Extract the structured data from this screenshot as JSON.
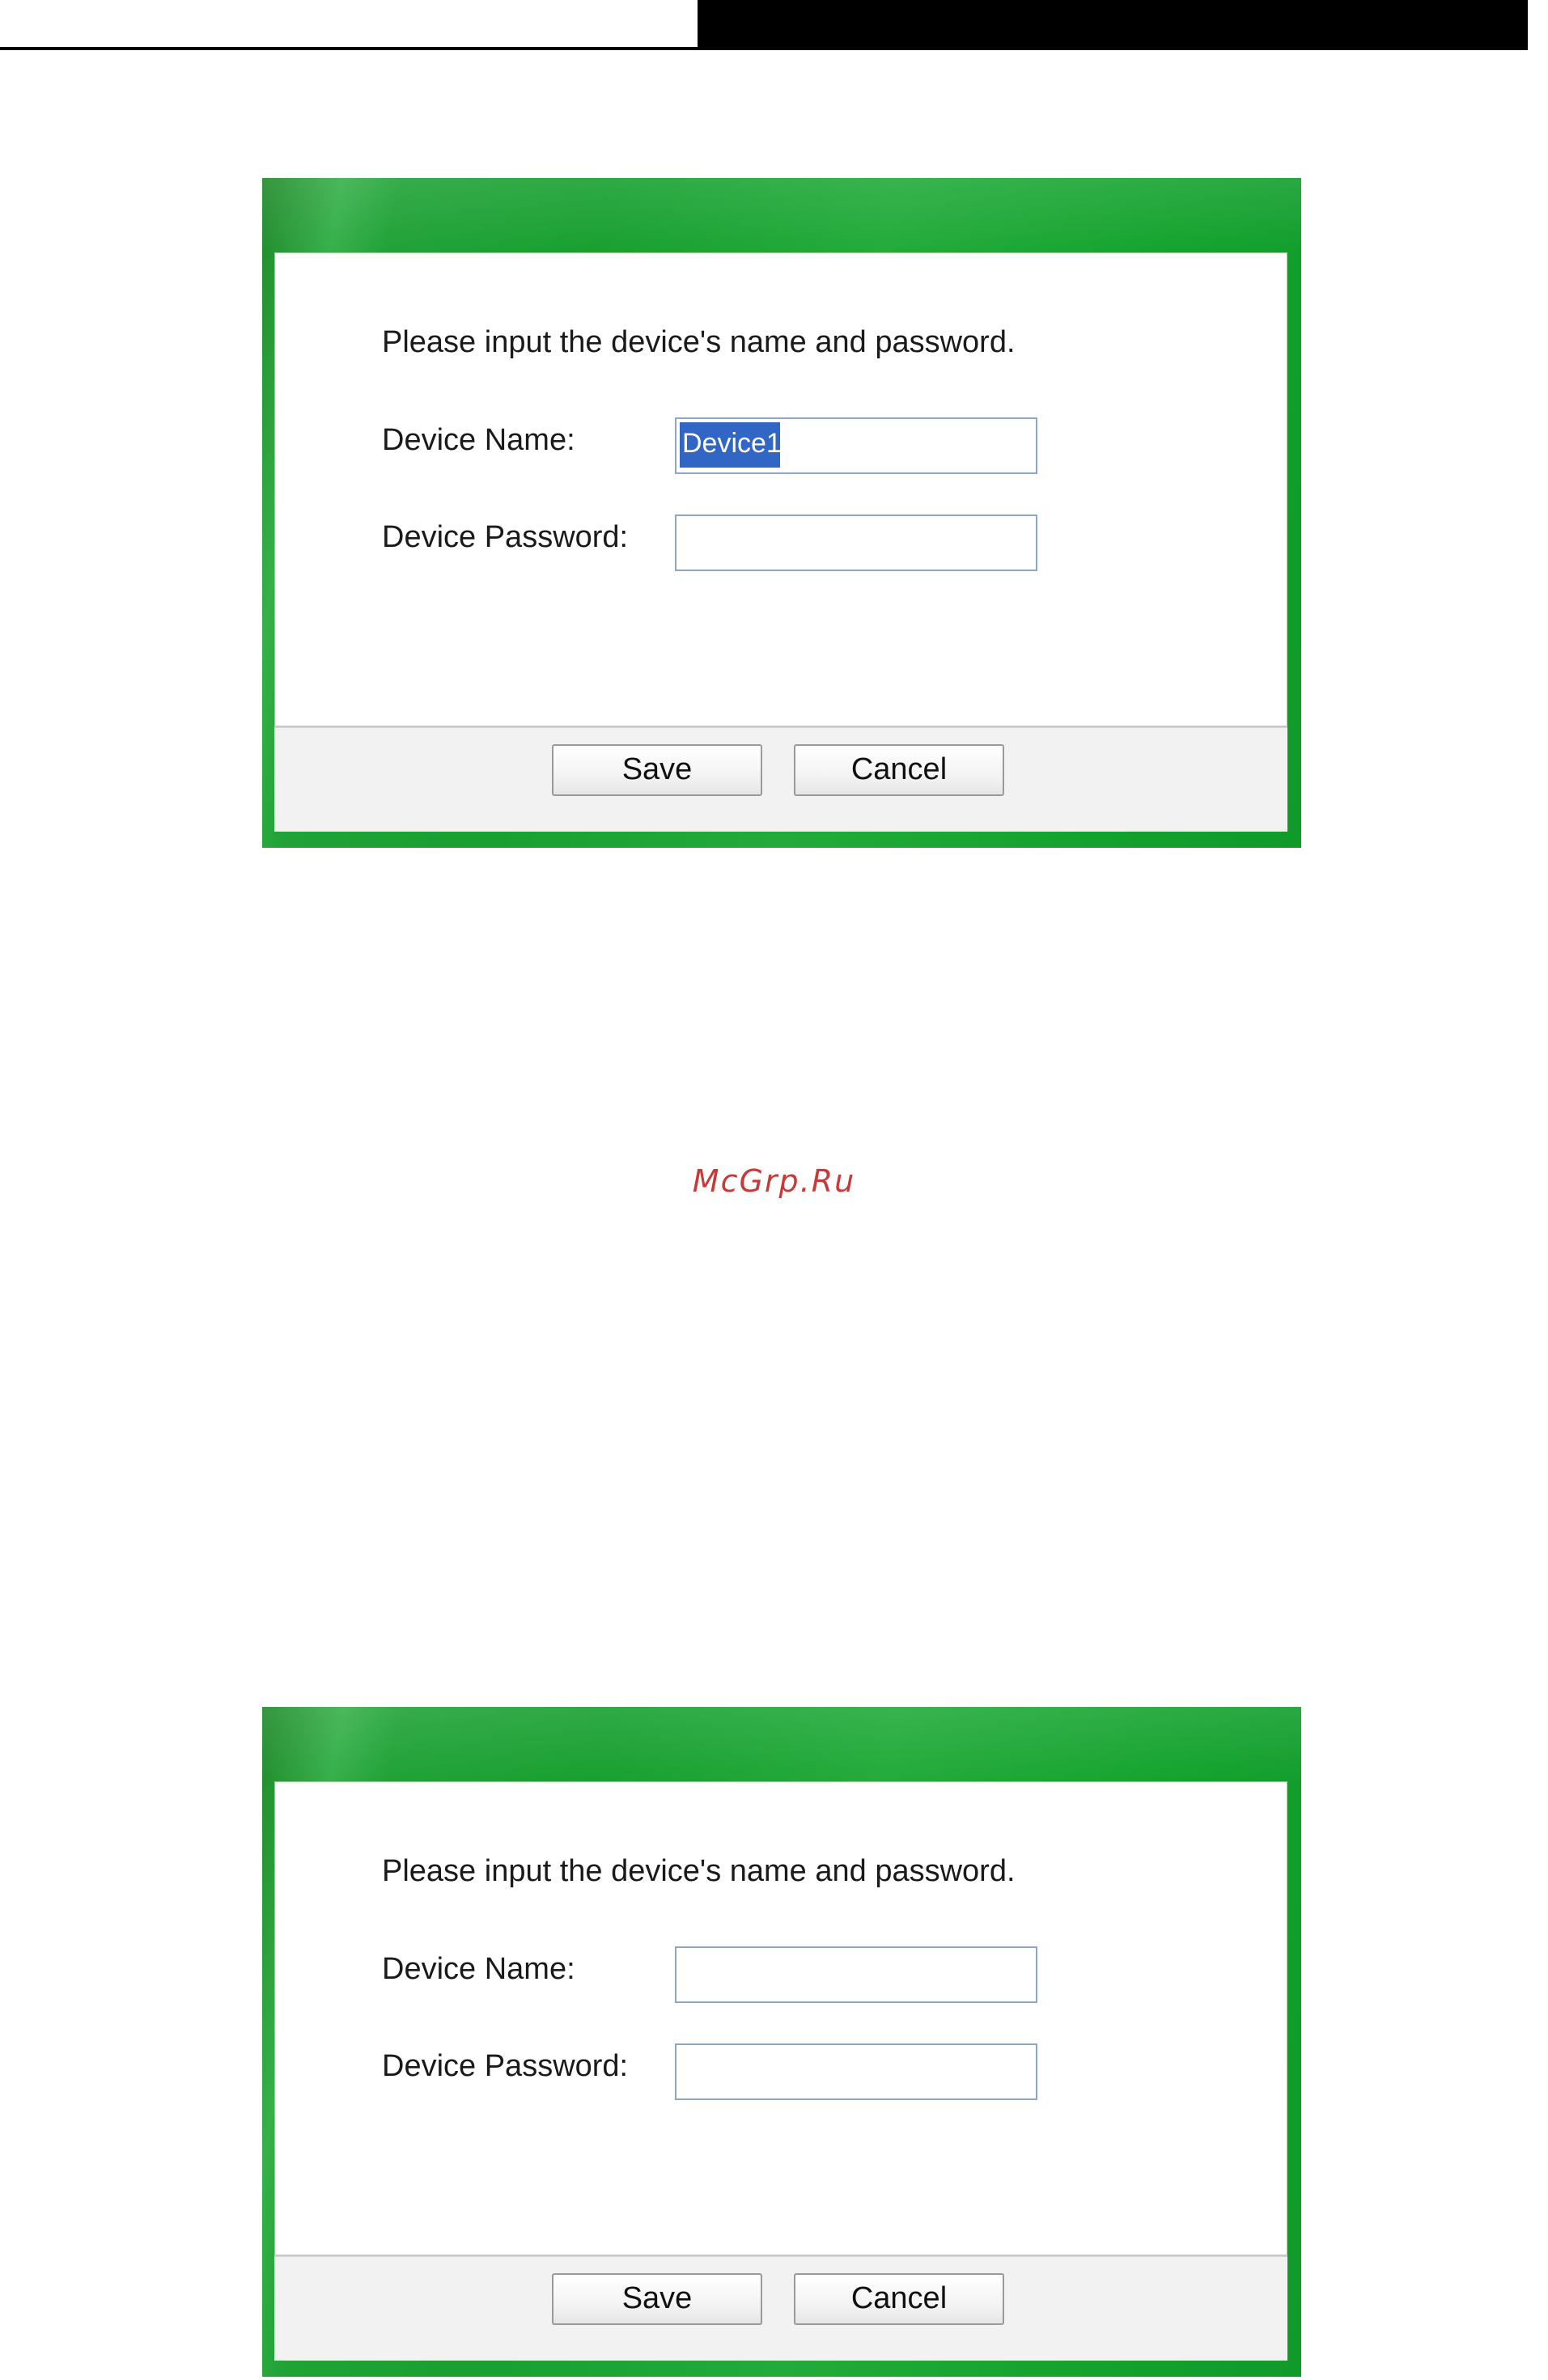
{
  "watermark": "McGrp.Ru",
  "dialogs": [
    {
      "prompt": "Please input the device's name and password.",
      "device_name_label": "Device Name:",
      "device_name_value": "Device1",
      "device_name_selected": true,
      "device_password_label": "Device Password:",
      "device_password_value": "",
      "save_label": "Save",
      "cancel_label": "Cancel"
    },
    {
      "prompt": "Please input the device's name and password.",
      "device_name_label": "Device Name:",
      "device_name_value": "",
      "device_password_label": "Device Password:",
      "device_password_value": "",
      "save_label": "Save",
      "cancel_label": "Cancel"
    }
  ],
  "colors": {
    "dialog_frame": "#18a030",
    "selection": "#3166c6",
    "watermark": "#c73a3a"
  }
}
